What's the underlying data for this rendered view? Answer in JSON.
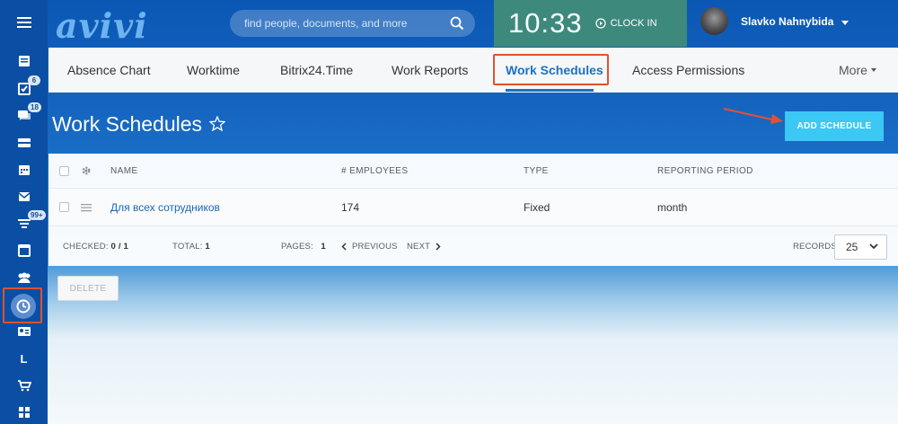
{
  "header": {
    "logo_text": "avivi",
    "search_placeholder": "find people, documents, and more",
    "clock_time": "10:33",
    "clock_in_label": "CLOCK IN",
    "user_name": "Slavko Nahnybida"
  },
  "sidebar": {
    "items": [
      {
        "icon": "menu-icon"
      },
      {
        "icon": "feed-icon"
      },
      {
        "icon": "tasks-icon",
        "badge": "6"
      },
      {
        "icon": "chat-icon",
        "badge": "18"
      },
      {
        "icon": "inbox-icon"
      },
      {
        "icon": "calendar-icon"
      },
      {
        "icon": "mail-icon"
      },
      {
        "icon": "filter-icon",
        "badge": "99+"
      },
      {
        "icon": "window-icon"
      },
      {
        "icon": "team-icon"
      },
      {
        "icon": "clock-icon"
      },
      {
        "icon": "contact-card-icon"
      },
      {
        "icon": "letter-l-icon",
        "label": "L"
      },
      {
        "icon": "cart-icon"
      },
      {
        "icon": "apps-grid-icon"
      }
    ]
  },
  "tabs": {
    "items": [
      "Absence Chart",
      "Worktime",
      "Bitrix24.Time",
      "Work Reports",
      "Work Schedules",
      "Access Permissions"
    ],
    "active_index": 4,
    "more_label": "More"
  },
  "page": {
    "title": "Work Schedules",
    "add_button_label": "ADD SCHEDULE"
  },
  "table": {
    "columns": [
      "NAME",
      "# EMPLOYEES",
      "TYPE",
      "REPORTING PERIOD"
    ],
    "rows": [
      {
        "name": "Для всех сотрудников",
        "employees": "174",
        "type": "Fixed",
        "period": "month"
      }
    ]
  },
  "footer": {
    "checked_label": "CHECKED:",
    "checked_value": "0 / 1",
    "total_label": "TOTAL:",
    "total_value": "1",
    "pages_label": "PAGES:",
    "pages_value": "1",
    "prev_label": "PREVIOUS",
    "next_label": "NEXT",
    "records_label": "RECORDS:",
    "records_value": "25",
    "delete_label": "DELETE"
  },
  "colors": {
    "accent": "#1a73c2",
    "highlight": "#e5502f",
    "add_button": "#3bc8f5",
    "clock_block": "#3d8a7c"
  }
}
